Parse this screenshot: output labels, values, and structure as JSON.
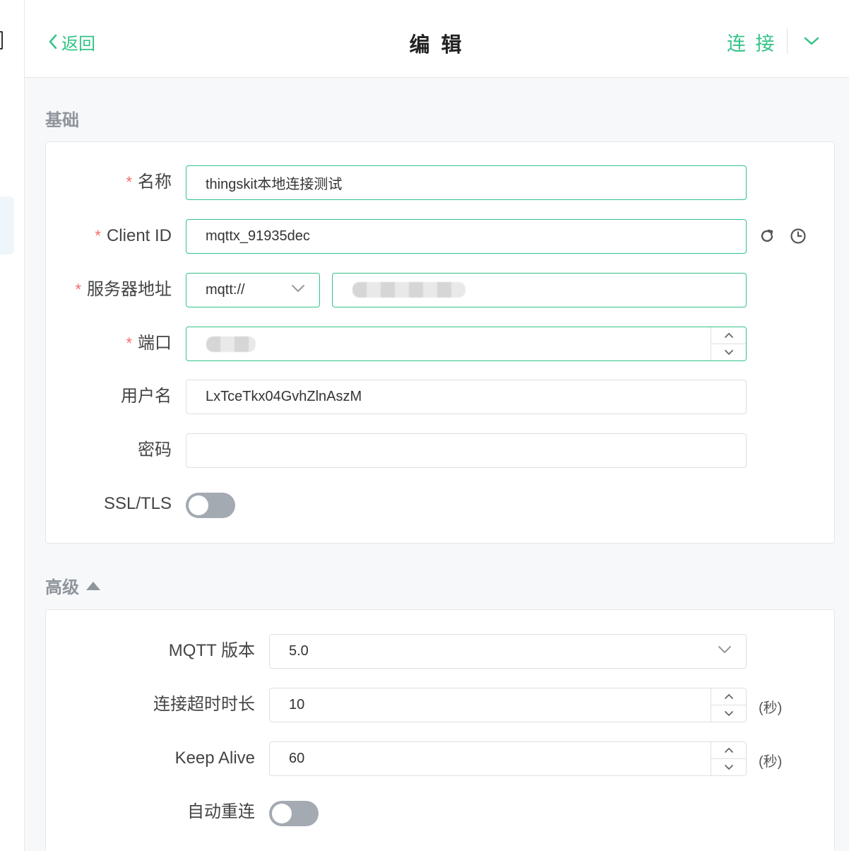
{
  "header": {
    "back_label": "返回",
    "title": "编 辑",
    "connect_label": "连 接"
  },
  "basic": {
    "section_title": "基础",
    "name": {
      "label": "名称",
      "value": "thingskit本地连接测试"
    },
    "client_id": {
      "label": "Client ID",
      "value": "mqttx_91935dec"
    },
    "server": {
      "label": "服务器地址",
      "protocol": "mqtt://",
      "host": ""
    },
    "port": {
      "label": "端口",
      "value": ""
    },
    "username": {
      "label": "用户名",
      "value": "LxTceTkx04GvhZlnAszM"
    },
    "password": {
      "label": "密码",
      "value": ""
    },
    "ssl": {
      "label": "SSL/TLS",
      "enabled": false
    }
  },
  "advanced": {
    "section_title": "高级",
    "mqtt_version": {
      "label": "MQTT 版本",
      "value": "5.0"
    },
    "connect_timeout": {
      "label": "连接超时时长",
      "value": "10",
      "unit": "(秒)"
    },
    "keep_alive": {
      "label": "Keep Alive",
      "value": "60",
      "unit": "(秒)"
    },
    "auto_reconnect": {
      "label": "自动重连",
      "enabled": false
    }
  },
  "colors": {
    "accent": "#34c388",
    "required": "#f56c6c",
    "toggle_off": "#a4aab2"
  }
}
